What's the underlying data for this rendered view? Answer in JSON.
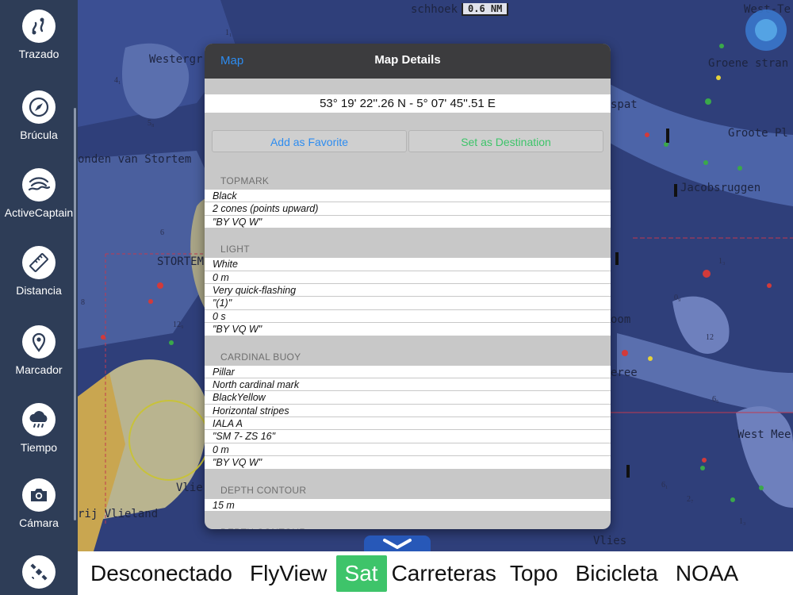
{
  "sidebar": {
    "items": [
      {
        "label": "Trazado",
        "icon": "route-icon"
      },
      {
        "label": "Brúcula",
        "icon": "compass-icon"
      },
      {
        "label": "ActiveCaptain",
        "icon": "activecaptain-icon"
      },
      {
        "label": "Distancia",
        "icon": "ruler-icon"
      },
      {
        "label": "Marcador",
        "icon": "map-pin-icon"
      },
      {
        "label": "Tiempo",
        "icon": "weather-cloud-icon"
      },
      {
        "label": "Cámara",
        "icon": "camera-icon"
      },
      {
        "label": "",
        "icon": "satellite-icon"
      }
    ]
  },
  "map": {
    "scale": "0.6 NM",
    "labels": [
      "Westergr",
      "onden van Stortem",
      "STORTEM",
      "rij Vlieland",
      "Vlie",
      "schhoek",
      "West-Te",
      "Groene stran",
      "spat",
      "Groote Pl",
      "Jacobsruggen",
      "oom",
      "eree",
      "West Mee",
      "Vlies"
    ],
    "depths": [
      "1₁",
      "4₁",
      "5₈",
      "6",
      "8",
      "12₉",
      "1₃",
      "0₉",
      "12",
      "6₅",
      "6₁",
      "2₇",
      "1₃"
    ]
  },
  "dialog": {
    "back_label": "Map",
    "title": "Map Details",
    "coordinates": "53° 19' 22''.26 N  -  5° 07' 45''.51 E",
    "add_favorite_label": "Add as Favorite",
    "set_destination_label": "Set as Destination",
    "sections": [
      {
        "header": "TOPMARK",
        "rows": [
          "Black",
          "2 cones (points upward)",
          "\"BY VQ W\""
        ]
      },
      {
        "header": "LIGHT",
        "rows": [
          "White",
          "0 m",
          "Very quick-flashing",
          "\"(1)\"",
          "0 s",
          "\"BY VQ W\""
        ]
      },
      {
        "header": "CARDINAL BUOY",
        "rows": [
          "Pillar",
          "North cardinal mark",
          "BlackYellow",
          "Horizontal stripes",
          "IALA A",
          "\"SM 7- ZS 16\"",
          "0 m",
          "\"BY VQ W\""
        ]
      },
      {
        "header": "DEPTH CONTOUR",
        "rows": [
          "15 m"
        ]
      },
      {
        "header": "DEPTH CONTOUR",
        "rows": []
      }
    ]
  },
  "layers": {
    "items": [
      "Desconectado",
      "FlyView",
      "Sat",
      "Carreteras",
      "Topo",
      "Bicicleta",
      "NOAA"
    ],
    "active": "Sat"
  },
  "colors": {
    "sidebar_bg": "#2e3d57",
    "accent_blue": "#2d8cf0",
    "accent_green": "#3ec46a",
    "header_bg": "#3c3c3e",
    "map_water": "#2f3f7a",
    "map_land": "#bdb998"
  }
}
